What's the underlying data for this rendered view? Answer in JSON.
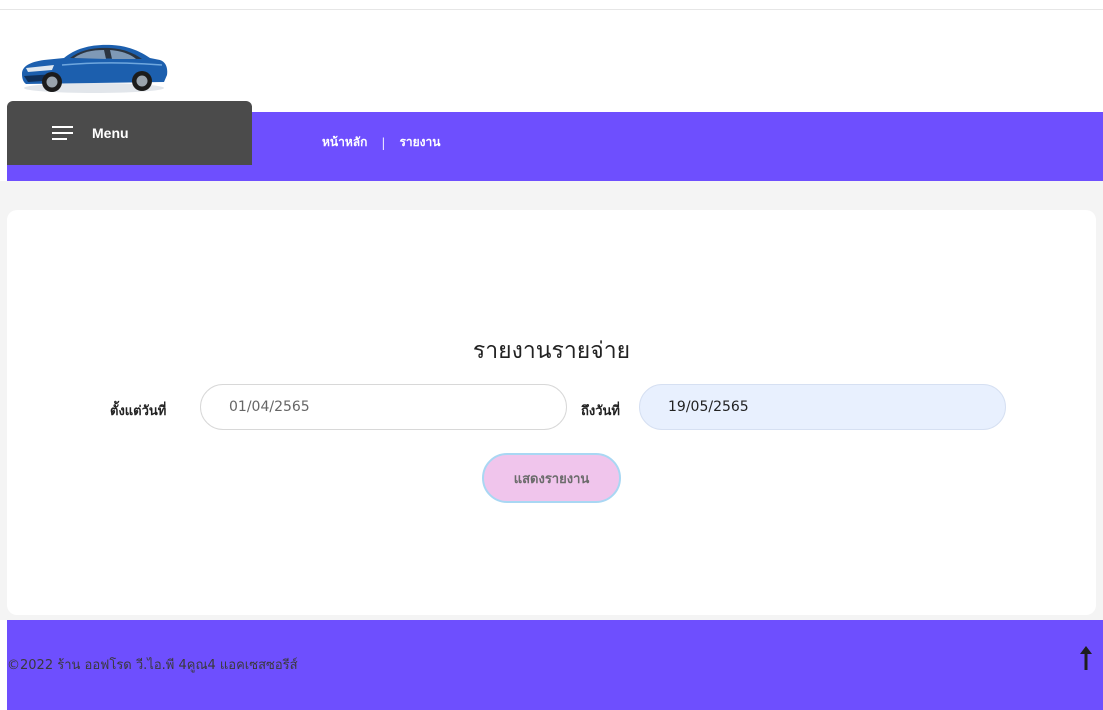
{
  "header": {
    "logo_icon": "blue-sedan-car-logo",
    "menu_label": "Menu",
    "menu_icon": "hamburger-icon",
    "breadcrumb": {
      "home": "หน้าหลัก",
      "separator": "|",
      "current": "รายงาน"
    }
  },
  "report": {
    "title": "รายงานรายจ่าย",
    "from_label": "ตั้งแต่วันที่",
    "from_value": "01/04/2565",
    "to_label": "ถึงวันที่",
    "to_value": "19/05/2565",
    "submit_label": "แสดงรายงาน"
  },
  "footer": {
    "copyright": "©2022 ร้าน ออฟโรด วี.ไอ.พี 4คูณ4 แอคเซสซอรีส์",
    "scroll_top_icon": "arrow-up-icon"
  },
  "colors": {
    "accent": "#6e4ffe",
    "menu_bg": "#4b4b4b",
    "button_bg": "#f0c5ec",
    "button_border": "#a9d7f3",
    "autofill_bg": "#e8f0fe"
  }
}
